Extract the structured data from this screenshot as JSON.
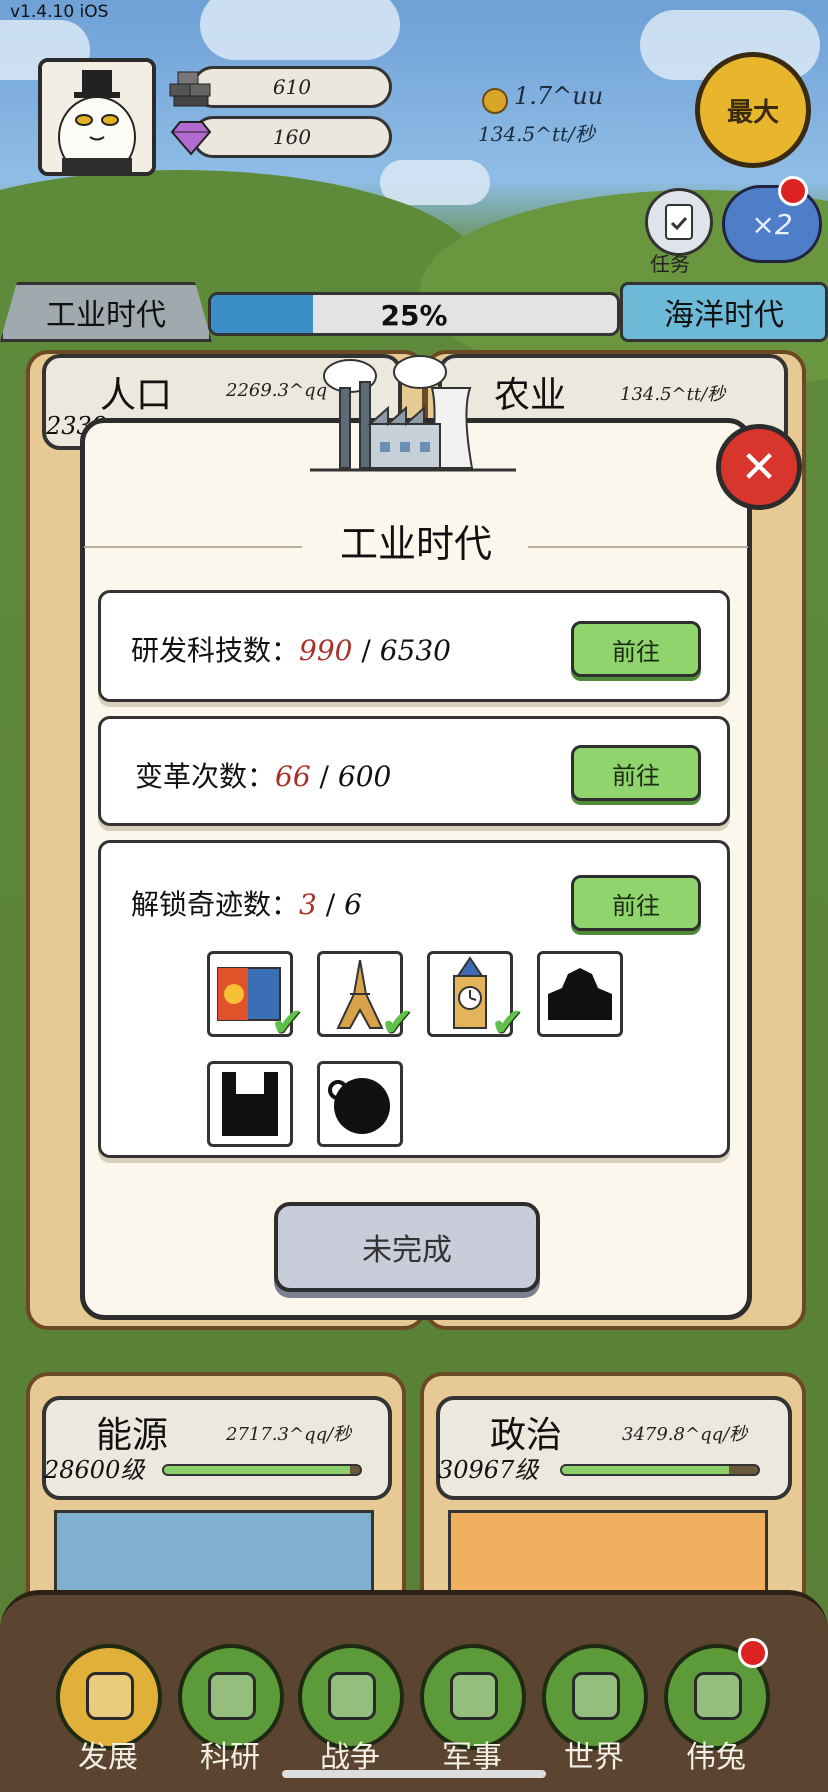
{
  "version": "v1.4.10 iOS",
  "resources": {
    "stone": "610",
    "gems": "160",
    "coins_total": "1.7^uu",
    "coins_rate": "134.5^tt/秒"
  },
  "buttons": {
    "max": "最大",
    "task": "任务",
    "multiplier": "×2"
  },
  "era": {
    "current": "工业时代",
    "next": "海洋时代",
    "progress_label": "25%",
    "progress": 0.25
  },
  "cards": [
    {
      "title": "人口",
      "rate": "2269.3^qq",
      "level": "2339…"
    },
    {
      "title": "农业",
      "rate": "134.5^tt/秒",
      "level": ""
    },
    {
      "title": "能源",
      "rate": "2717.3^qq/秒",
      "level": "28600级",
      "progress": 0.95
    },
    {
      "title": "政治",
      "rate": "3479.8^qq/秒",
      "level": "30967级",
      "progress": 0.85
    }
  ],
  "modal": {
    "title": "工业时代",
    "requirements": [
      {
        "label": "研发科技数：",
        "current": "990",
        "sep": " / ",
        "total": "6530",
        "button": "前往"
      },
      {
        "label": "变革次数：",
        "current": "66",
        "sep": " / ",
        "total": "600",
        "button": "前往"
      },
      {
        "label": "解锁奇迹数：",
        "current": "3",
        "sep": " / ",
        "total": "6",
        "button": "前往"
      }
    ],
    "wonders": [
      {
        "icon": "poster-wonder-icon",
        "unlocked": true
      },
      {
        "icon": "eiffel-tower-icon",
        "unlocked": true
      },
      {
        "icon": "big-ben-icon",
        "unlocked": true
      },
      {
        "icon": "locked-building-icon",
        "unlocked": false
      },
      {
        "icon": "locked-tower-icon",
        "unlocked": false
      },
      {
        "icon": "locked-sphere-icon",
        "unlocked": false
      }
    ],
    "status_button": "未完成",
    "close_icon": "close-icon"
  },
  "nav": [
    {
      "label": "发展",
      "icon": "develop-icon",
      "color": "#e0b03a"
    },
    {
      "label": "科研",
      "icon": "flask-icon",
      "color": "#5c9a3a"
    },
    {
      "label": "战争",
      "icon": "swords-icon",
      "color": "#5c9a3a"
    },
    {
      "label": "军事",
      "icon": "military-icon",
      "color": "#5c9a3a"
    },
    {
      "label": "世界",
      "icon": "globe-icon",
      "color": "#5c9a3a"
    },
    {
      "label": "伟兔",
      "icon": "rabbit-portrait-icon",
      "color": "#5c9a3a"
    }
  ]
}
